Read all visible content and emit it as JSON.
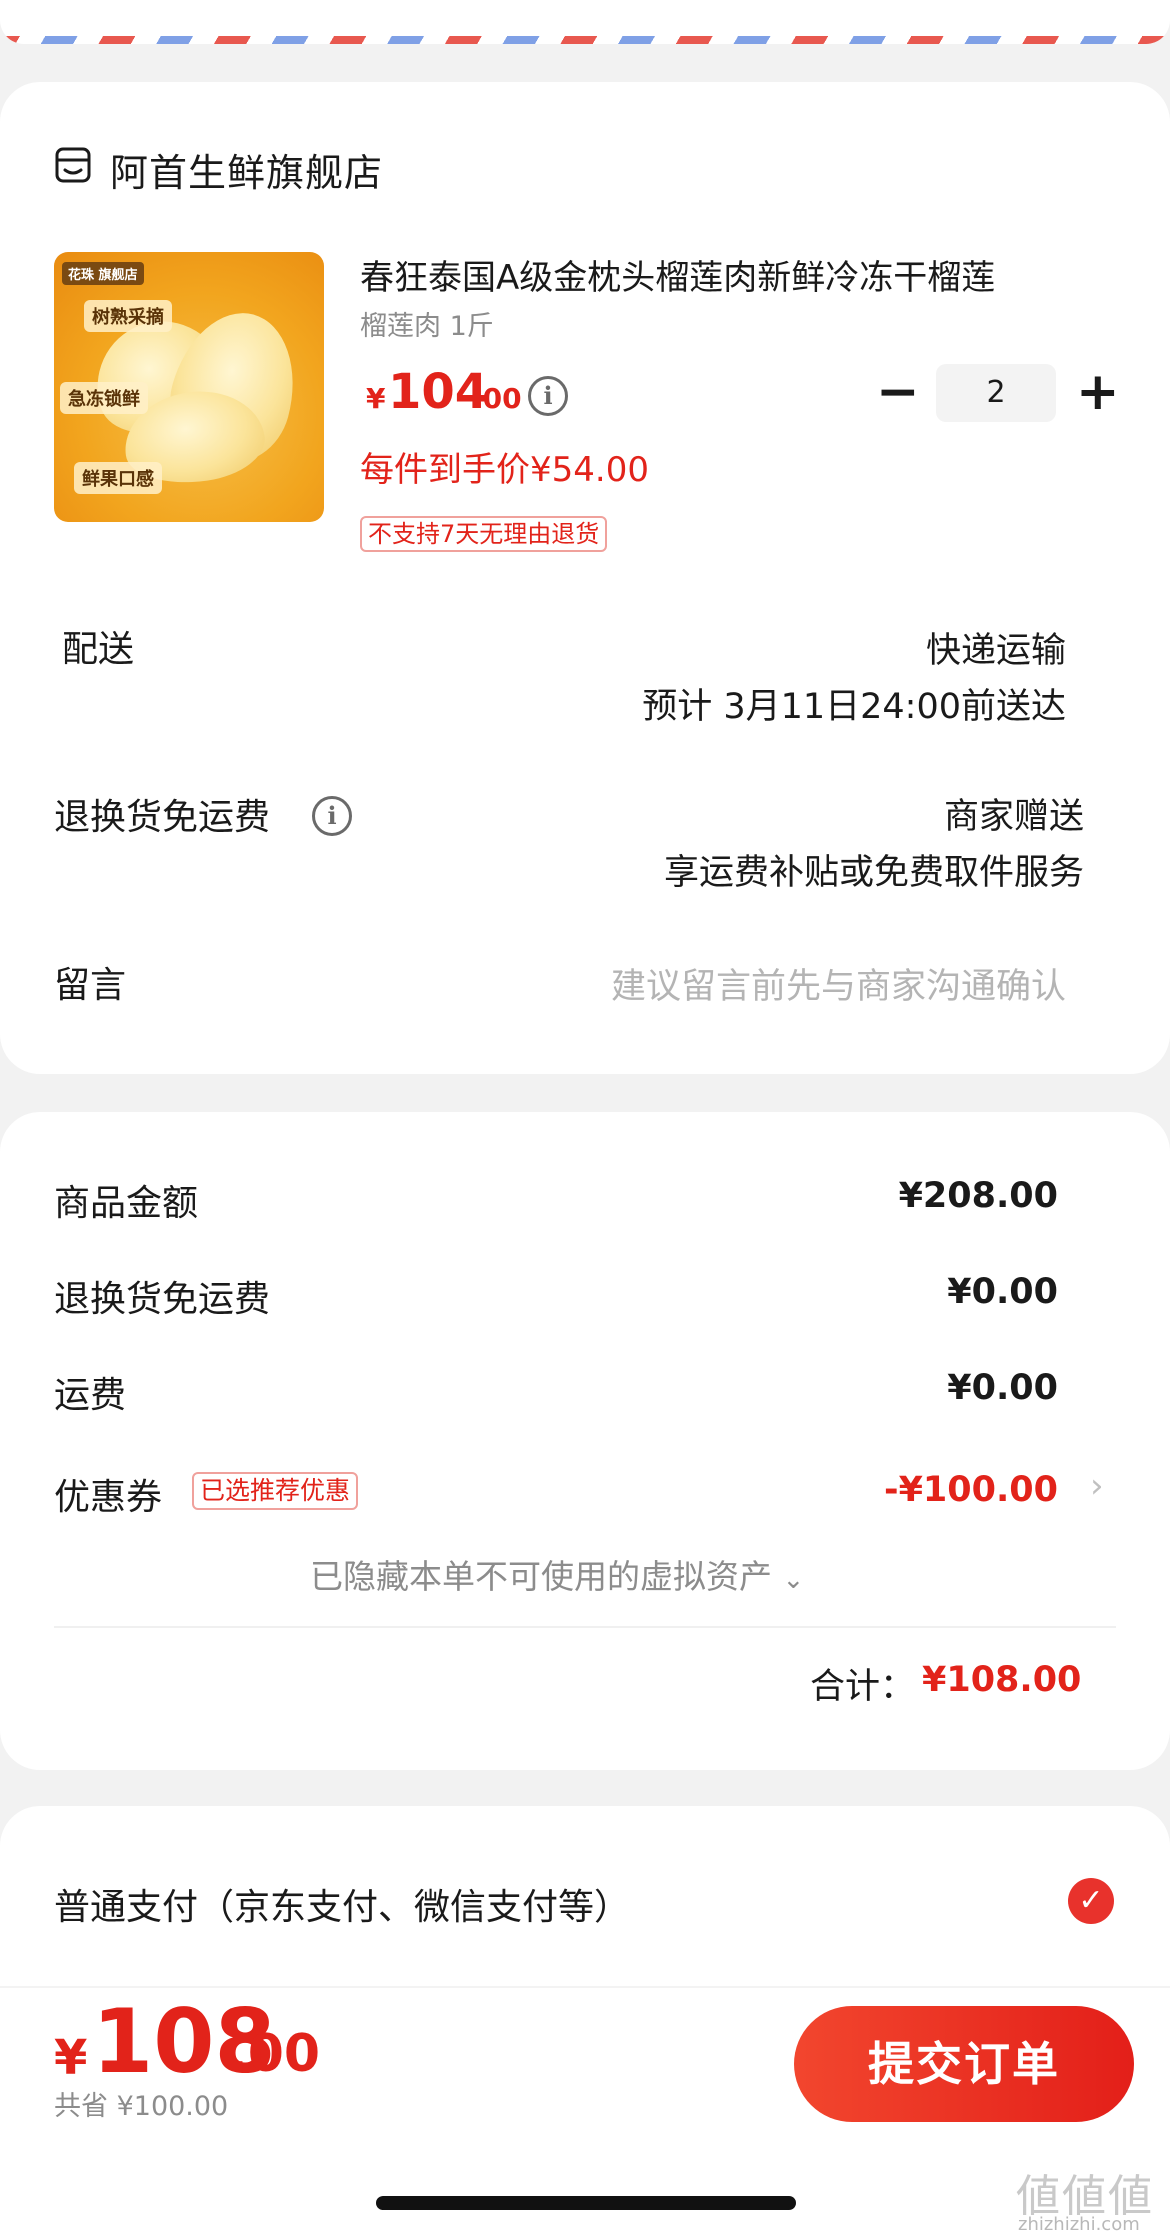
{
  "store": {
    "name": "阿首生鲜旗舰店",
    "icon": "store-icon"
  },
  "product": {
    "title": "春狂泰国A级金枕头榴莲肉新鲜冷冻干榴莲",
    "spec": "榴莲肉 1斤",
    "price_symbol": "¥",
    "price_integer": "104",
    "price_decimal": ".00",
    "per_item_price": "每件到手价¥54.00",
    "no_return_tag": "不支持7天无理由退货",
    "quantity": "2",
    "image_tags": [
      "树熟采摘",
      "急冻锁鲜",
      "鲜果口感"
    ],
    "image_brand": "花珠 旗舰店"
  },
  "delivery": {
    "label": "配送",
    "method": "快递运输",
    "eta": "预计 3月11日24:00前送达"
  },
  "return_shipping": {
    "label": "退换货免运费",
    "value_line1": "商家赠送",
    "value_line2": "享运费补贴或免费取件服务"
  },
  "message": {
    "label": "留言",
    "placeholder": "建议留言前先与商家沟通确认"
  },
  "summary": {
    "goods_label": "商品金额",
    "goods_value": "¥208.00",
    "return_label": "退换货免运费",
    "return_value": "¥0.00",
    "shipping_label": "运费",
    "shipping_value": "¥0.00",
    "coupon_label": "优惠券",
    "coupon_tag": "已选推荐优惠",
    "coupon_value": "-¥100.00",
    "hidden_assets": "已隐藏本单不可使用的虚拟资产",
    "total_label": "合计：",
    "total_value": "¥108.00"
  },
  "payment": {
    "method_label": "普通支付（京东支付、微信支付等）",
    "selected": true
  },
  "footer": {
    "price_symbol": "¥",
    "price_integer": "108",
    "price_decimal": ".00",
    "saved": "共省 ¥100.00",
    "submit_label": "提交订单"
  },
  "watermark": {
    "logo": "値値値",
    "url": "zhizhizhi.com"
  },
  "colors": {
    "accent": "#e2231a",
    "background": "#f2f2f2"
  }
}
